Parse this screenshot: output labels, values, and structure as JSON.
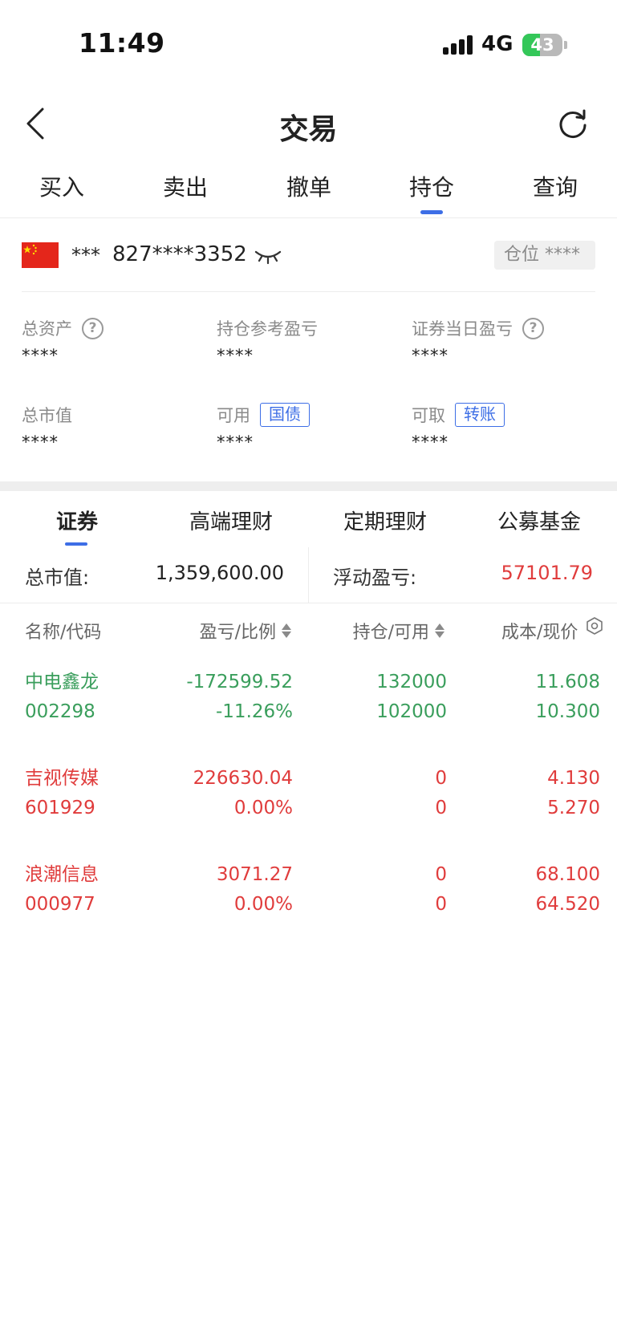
{
  "status_bar": {
    "time": "11:49",
    "network": "4G",
    "battery_level": 43,
    "battery_text": "43"
  },
  "nav": {
    "title": "交易"
  },
  "tabs": [
    {
      "label": "买入",
      "active": false
    },
    {
      "label": "卖出",
      "active": false
    },
    {
      "label": "撤单",
      "active": false
    },
    {
      "label": "持仓",
      "active": true
    },
    {
      "label": "查询",
      "active": false
    }
  ],
  "account": {
    "prefix": "***",
    "number": "827****3352",
    "position_label": "仓位",
    "position_value": "****"
  },
  "summary": [
    {
      "label": "总资产",
      "value": "****",
      "help": "?"
    },
    {
      "label": "持仓参考盈亏",
      "value": "****"
    },
    {
      "label": "证券当日盈亏",
      "value": "****",
      "help": "?"
    },
    {
      "label": "总市值",
      "value": "****"
    },
    {
      "label": "可用",
      "value": "****",
      "tag": "国债"
    },
    {
      "label": "可取",
      "value": "****",
      "tag": "转账"
    }
  ],
  "sub_tabs": [
    {
      "label": "证券",
      "active": true
    },
    {
      "label": "高端理财",
      "active": false
    },
    {
      "label": "定期理财",
      "active": false
    },
    {
      "label": "公募基金",
      "active": false
    }
  ],
  "totals": {
    "market_value_label": "总市值:",
    "market_value": "1,359,600.00",
    "floating_pl_label": "浮动盈亏:",
    "floating_pl": "57101.79"
  },
  "table": {
    "headers": [
      "名称/代码",
      "盈亏/比例",
      "持仓/可用",
      "成本/现价"
    ],
    "rows": [
      {
        "name": "中电鑫龙",
        "code": "002298",
        "pl": "-172599.52",
        "ratio": "-11.26%",
        "holding": "132000",
        "available": "102000",
        "cost": "11.608",
        "price": "10.300",
        "color": "#3a9e5c"
      },
      {
        "name": "吉视传媒",
        "code": "601929",
        "pl": "226630.04",
        "ratio": "0.00%",
        "holding": "0",
        "available": "0",
        "cost": "4.130",
        "price": "5.270",
        "color": "#e03c3c"
      },
      {
        "name": "浪潮信息",
        "code": "000977",
        "pl": "3071.27",
        "ratio": "0.00%",
        "holding": "0",
        "available": "0",
        "cost": "68.100",
        "price": "64.520",
        "color": "#e03c3c"
      }
    ]
  },
  "colors": {
    "accent": "#3d6ee6",
    "gain": "#e03c3c",
    "loss": "#3a9e5c"
  }
}
